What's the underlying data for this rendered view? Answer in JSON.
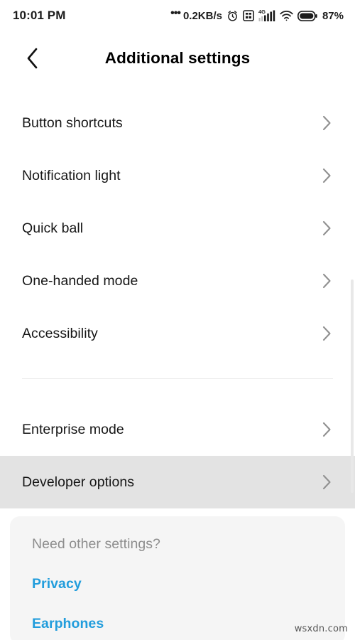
{
  "status_bar": {
    "clock": "10:01 PM",
    "network_speed": "0.2KB/s",
    "dots": "•••",
    "battery_percent": "87%",
    "icons": [
      {
        "name": "alarm-clock-icon",
        "label": "Alarm"
      },
      {
        "name": "screenshot-icon",
        "label": "Screen recorder"
      },
      {
        "name": "signal-4g-icon",
        "label": "4G"
      },
      {
        "name": "wifi-icon",
        "label": "Wi-Fi"
      },
      {
        "name": "battery-icon",
        "label": "Battery"
      }
    ],
    "signal_label": "4G"
  },
  "header": {
    "back_label": "Back",
    "title": "Additional settings"
  },
  "settings": {
    "group_one": [
      {
        "label": "Button shortcuts",
        "pressed": false
      },
      {
        "label": "Notification light",
        "pressed": false
      },
      {
        "label": "Quick ball",
        "pressed": false
      },
      {
        "label": "One-handed mode",
        "pressed": false
      },
      {
        "label": "Accessibility",
        "pressed": false
      }
    ],
    "group_two": [
      {
        "label": "Enterprise mode",
        "pressed": false
      },
      {
        "label": "Developer options",
        "pressed": true
      }
    ]
  },
  "footer": {
    "heading": "Need other settings?",
    "links": [
      {
        "label": "Privacy"
      },
      {
        "label": "Earphones"
      }
    ]
  },
  "watermark": {
    "text": "wsxdn.com"
  },
  "colors": {
    "accent_link": "#229ddc",
    "pressed_row": "#e3e3e3",
    "card_bg": "#f5f5f5",
    "divider": "#ececec",
    "chevron": "#909090",
    "muted_text": "#8d8d8d"
  }
}
